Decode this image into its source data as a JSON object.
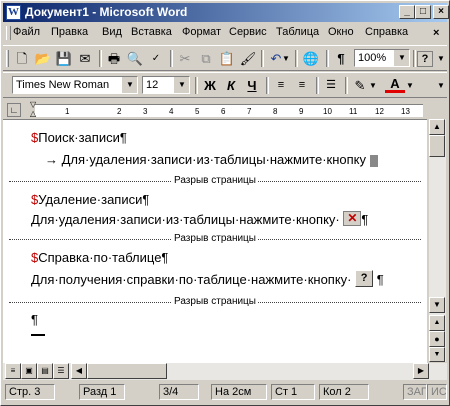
{
  "window": {
    "title": "Документ1 - Microsoft Word"
  },
  "menubar": {
    "items": [
      "Файл",
      "Правка",
      "Вид",
      "Вставка",
      "Формат",
      "Сервис",
      "Таблица",
      "Окно",
      "Справка"
    ]
  },
  "toolbar_standard": {
    "zoom": "100%"
  },
  "toolbar_format": {
    "font": "Times New Roman",
    "size": "12",
    "bold": "Ж",
    "italic": "К",
    "underline": "Ч"
  },
  "document": {
    "heading1": "Поиск·записи¶",
    "line1": "→    Для·удаления·записи·из·таблицы·нажмите·кнопку",
    "page_break": "Разрыв страницы",
    "heading2": "Удаление·записи¶",
    "line2": "Для·удаления·записи·из·таблицы·нажмите·кнопку·",
    "heading3": "Справка·по·таблице¶",
    "line3": "Для·получения·справки·по·таблице·нажмите·кнопку·",
    "pilcrow": "¶",
    "marker": "$",
    "help_btn": "?"
  },
  "statusbar": {
    "page": "Стр. 3",
    "section": "Разд 1",
    "pages": "3/4",
    "at": "На 2см",
    "line": "Ст 1",
    "col": "Кол 2",
    "rec": "ЗАП",
    "trk": "ИС"
  },
  "colors": {
    "title_start": "#0a246a",
    "title_end": "#a6caf0",
    "marker": "#c00000",
    "chrome": "#d4d0c8"
  }
}
